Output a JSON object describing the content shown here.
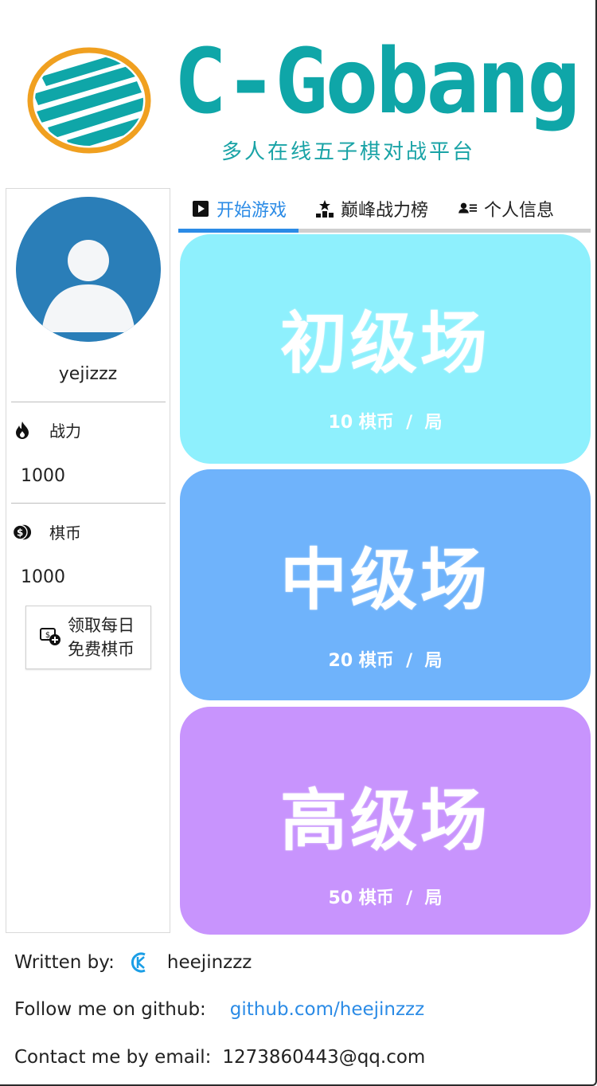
{
  "header": {
    "logo_title": "C-Gobang",
    "logo_subtitle": "多人在线五子棋对战平台"
  },
  "sidebar": {
    "username": "yejizzz",
    "power_label": "战力",
    "power_value": "1000",
    "coins_label": "棋币",
    "coins_value": "1000",
    "claim_label": "领取每日免费棋币"
  },
  "tabs": [
    {
      "label": "开始游戏",
      "icon": "play-icon",
      "active": true
    },
    {
      "label": "巅峰战力榜",
      "icon": "ranking-icon",
      "active": false
    },
    {
      "label": "个人信息",
      "icon": "user-card-icon",
      "active": false
    }
  ],
  "rooms": [
    {
      "title": "初级场",
      "price": "10 棋币  /  局",
      "color": "#8ef0fd"
    },
    {
      "title": "中级场",
      "price": "20 棋币  /  局",
      "color": "#6fb3fb"
    },
    {
      "title": "高级场",
      "price": "50 棋币  /  局",
      "color": "#c894fd"
    }
  ],
  "footer": {
    "written_by_label": "Written by:",
    "author": "heejinzzz",
    "github_label": "Follow me on github:",
    "github_link": "github.com/heejinzzz",
    "email_label": "Contact me by email:",
    "email": "1273860443@qq.com"
  },
  "colors": {
    "brand_teal": "#0fa6a8",
    "logo_orange": "#f0a020",
    "accent_blue": "#2b8be6"
  }
}
